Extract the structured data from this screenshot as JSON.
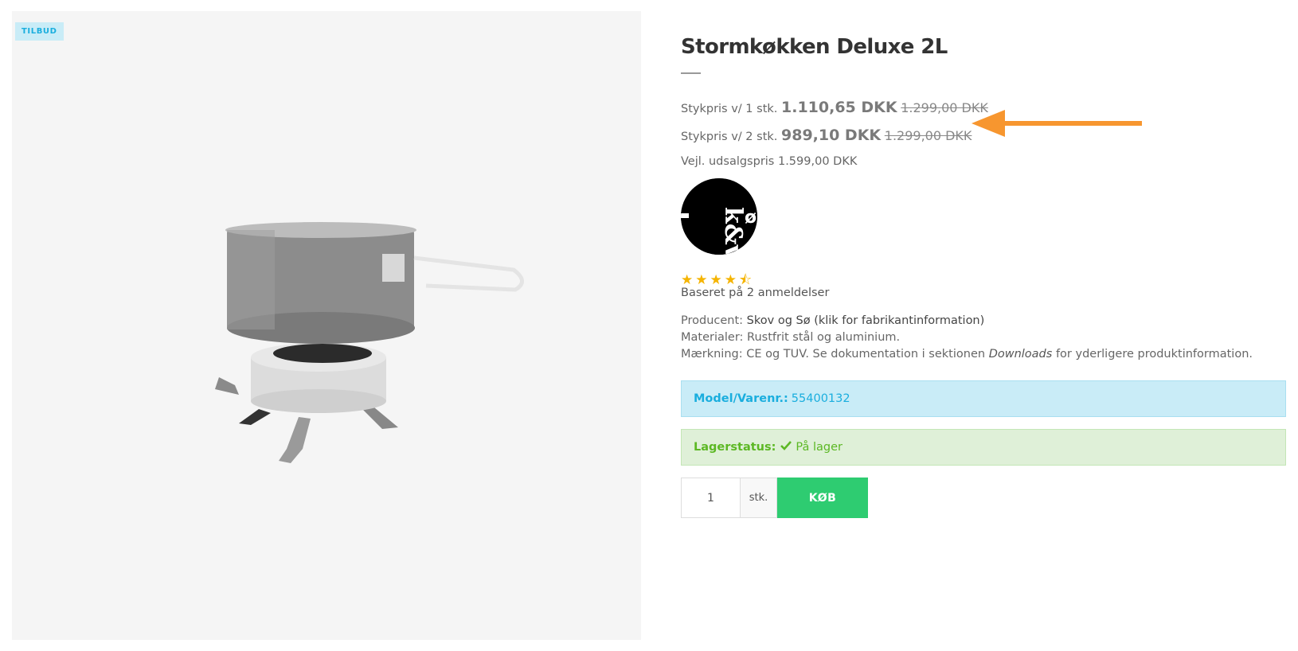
{
  "gallery": {
    "badge": "TILBUD"
  },
  "product": {
    "title": "Stormkøkken Deluxe 2L",
    "prices": [
      {
        "label": "Stykpris v/ 1 stk.",
        "price": "1.110,65 DKK",
        "old_price": "1.299,00 DKK"
      },
      {
        "label": "Stykpris v/ 2 stk.",
        "price": "989,10 DKK",
        "old_price": "1.299,00 DKK"
      }
    ],
    "rrp": "Vejl. udsalgspris 1.599,00 DKK",
    "rating": {
      "value": 4.5,
      "max": 5,
      "stars": "★★★★⯪",
      "review_text": "Baseret på 2 anmeldelser"
    },
    "producer": {
      "label": "Producent:",
      "name": "Skov og Sø",
      "link": "(klik for fabrikantinformation)"
    },
    "materials": "Materialer: Rustfrit stål og aluminium.",
    "marking": {
      "prefix": "Mærkning: CE og TUV. Se dokumentation i sektionen",
      "emphasis": "Downloads",
      "suffix": "for yderligere produktinformation."
    },
    "model": {
      "label": "Model/Varenr.:",
      "value": "55400132"
    },
    "stock": {
      "label": "Lagerstatus:",
      "value": "På lager"
    },
    "buy": {
      "qty": "1",
      "unit": "stk.",
      "button": "KØB"
    }
  },
  "colors": {
    "accent_arrow": "#f7962f",
    "buy_button": "#2ecc71",
    "info_blue": "#1aaede",
    "success_green": "#5cb824"
  },
  "icons": [
    "arrow-left-icon",
    "check-icon",
    "star-icon",
    "half-star-icon"
  ]
}
